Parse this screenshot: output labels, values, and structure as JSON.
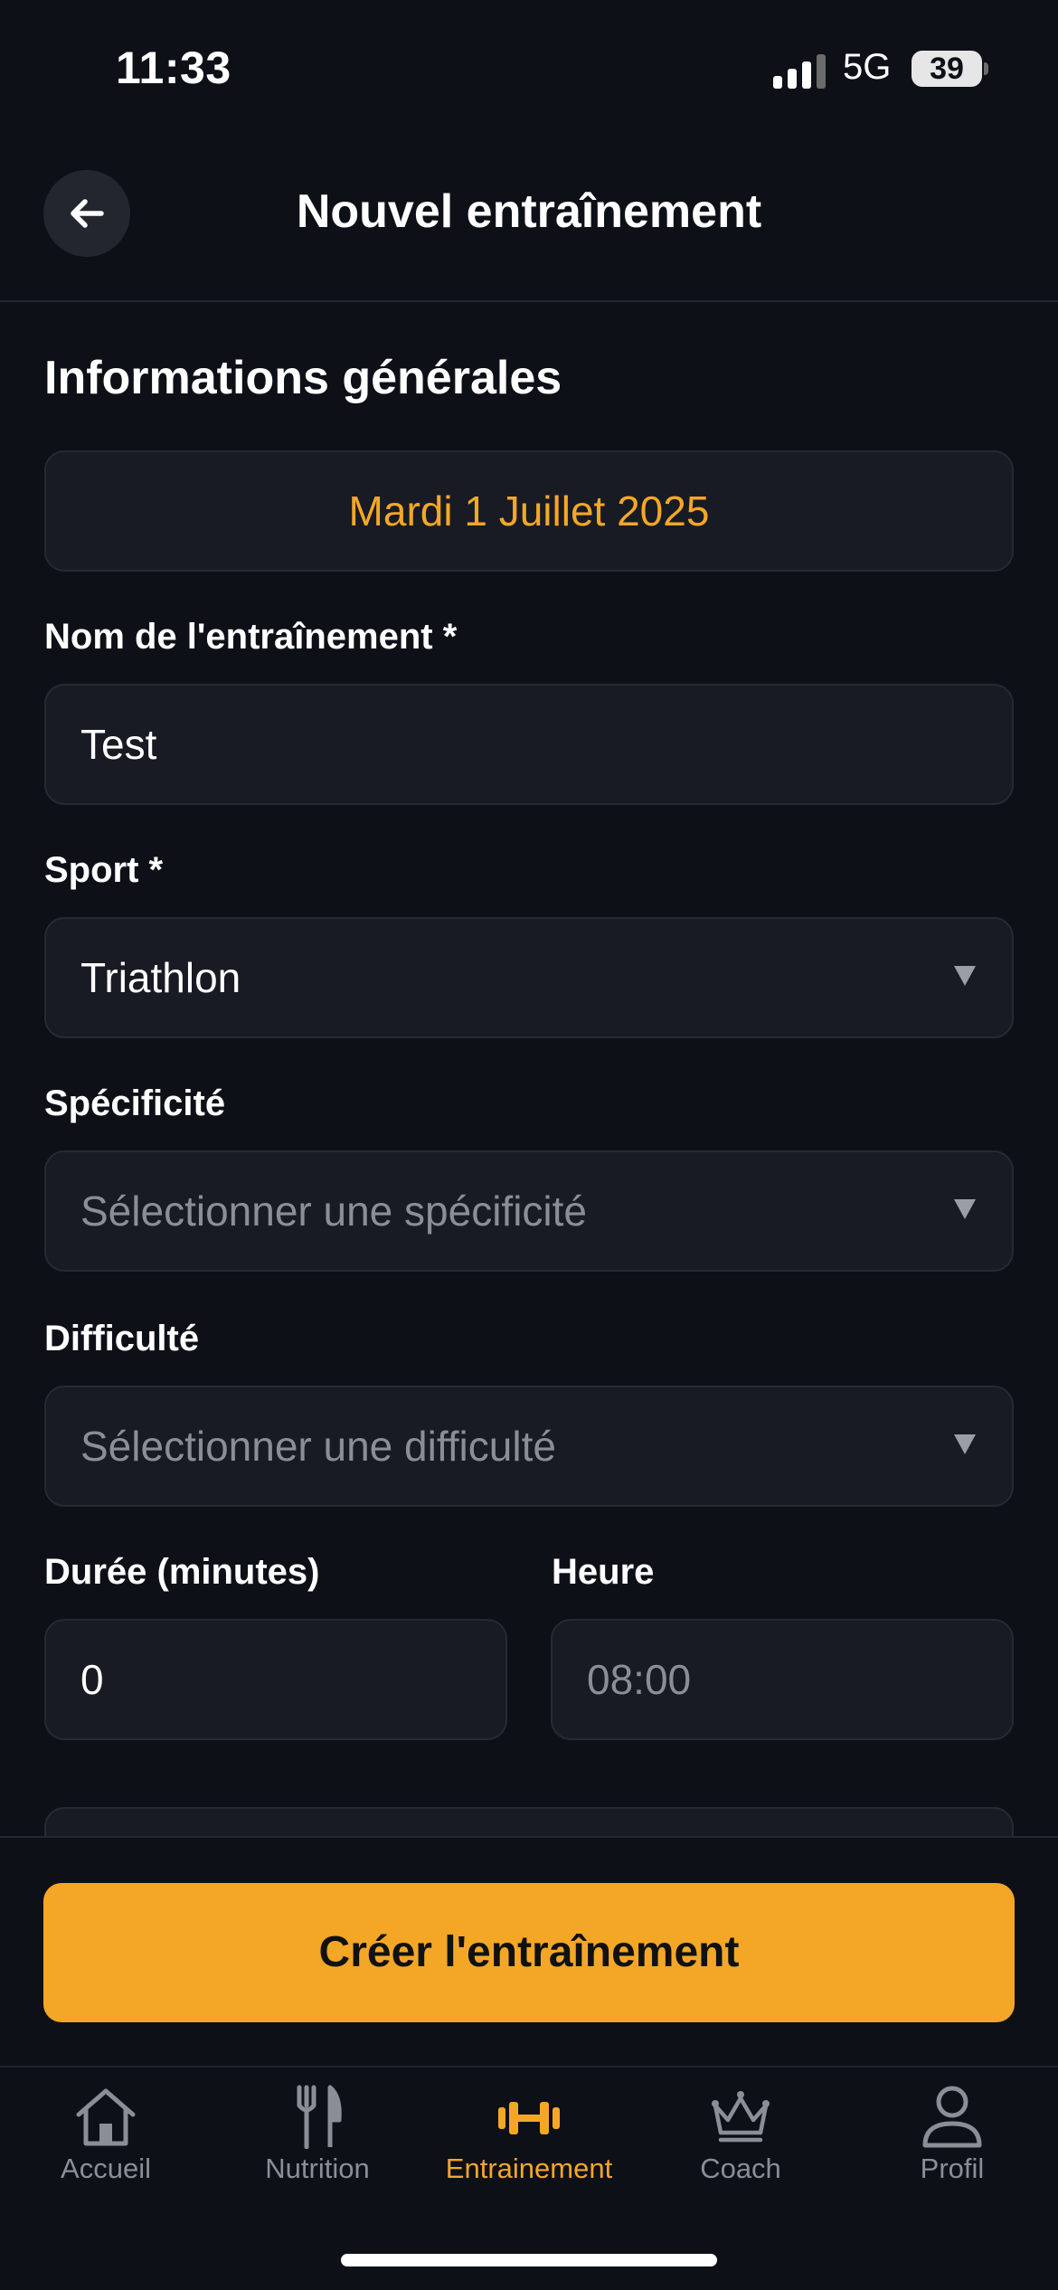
{
  "status_bar": {
    "time": "11:33",
    "network": "5G",
    "battery": "39"
  },
  "header": {
    "title": "Nouvel entraînement",
    "back_icon": "arrow-left-icon"
  },
  "form": {
    "section_title": "Informations générales",
    "date": "Mardi 1 Juillet 2025",
    "name": {
      "label": "Nom de l'entraînement *",
      "value": "Test"
    },
    "sport": {
      "label": "Sport *",
      "value": "Triathlon"
    },
    "specificity": {
      "label": "Spécificité",
      "placeholder": "Sélectionner une spécificité"
    },
    "difficulty": {
      "label": "Difficulté",
      "placeholder": "Sélectionner une difficulté"
    },
    "duration": {
      "label": "Durée (minutes)",
      "value": "0"
    },
    "time": {
      "label": "Heure",
      "placeholder": "08:00"
    }
  },
  "actions": {
    "create_label": "Créer l'entraînement"
  },
  "tab_bar": {
    "items": [
      {
        "label": "Accueil",
        "icon": "home-icon",
        "active": false
      },
      {
        "label": "Nutrition",
        "icon": "fork-knife-icon",
        "active": false
      },
      {
        "label": "Entrainement",
        "icon": "dumbbell-icon",
        "active": true
      },
      {
        "label": "Coach",
        "icon": "crown-icon",
        "active": false
      },
      {
        "label": "Profil",
        "icon": "user-icon",
        "active": false
      }
    ]
  },
  "colors": {
    "background": "#0d1017",
    "field": "#181b23",
    "accent": "#f4a727",
    "muted": "#8a8e97"
  }
}
